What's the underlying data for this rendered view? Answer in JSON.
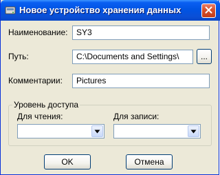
{
  "window": {
    "title": "Новое устройство хранения данных"
  },
  "form": {
    "name_label": "Наименование:",
    "name_value": "SY3",
    "path_label": "Путь:",
    "path_value": "C:\\Documents and Settings\\",
    "browse_label": "...",
    "comment_label": "Комментарии:",
    "comment_value": "Pictures"
  },
  "access": {
    "group_label": "Уровень доступа",
    "read_label": "Для чтения:",
    "read_value": "",
    "write_label": "Для записи:",
    "write_value": ""
  },
  "buttons": {
    "ok_label": "OK",
    "cancel_label": "Отмена"
  },
  "colors": {
    "titlebar": "#0054e3",
    "close_button": "#d9532f",
    "dialog_background": "#ece9d8",
    "field_border": "#7f9db9"
  },
  "icons": {
    "title": "disk-icon",
    "close": "close-icon",
    "combo": "chevron-down-icon"
  }
}
